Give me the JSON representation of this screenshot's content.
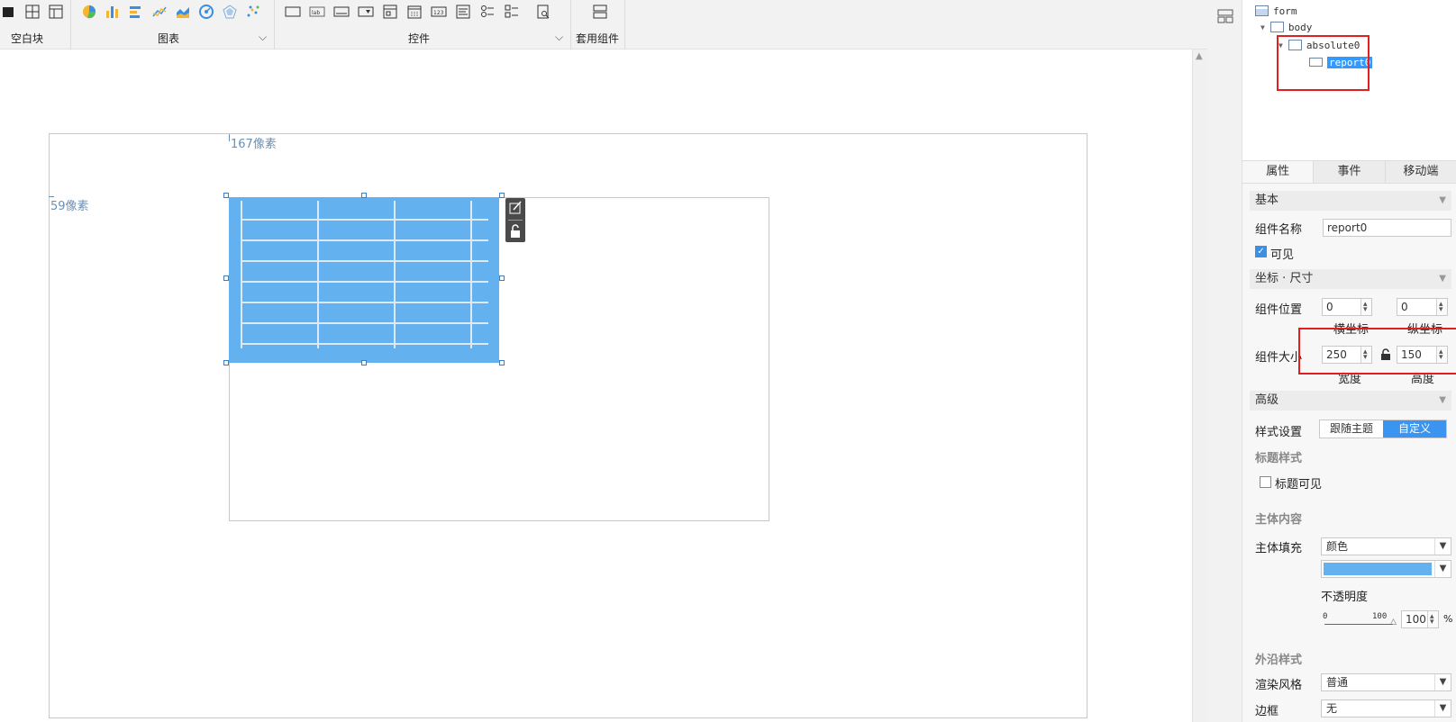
{
  "toolbar": {
    "groups": [
      {
        "label": "空白块"
      },
      {
        "label": "图表"
      },
      {
        "label": "控件"
      },
      {
        "label": "套用组件"
      }
    ]
  },
  "canvas": {
    "ruler_x": "167像素",
    "ruler_y": "59像素"
  },
  "tree": {
    "items": [
      "form",
      "body",
      "absolute0",
      "report0"
    ]
  },
  "tabs": [
    "属性",
    "事件",
    "移动端"
  ],
  "props": {
    "basic": "基本",
    "name_label": "组件名称",
    "name_value": "report0",
    "visible_label": "可见",
    "coord_section": "坐标 · 尺寸",
    "pos_label": "组件位置",
    "pos_x": "0",
    "pos_y": "0",
    "x_caption": "横坐标",
    "y_caption": "纵坐标",
    "size_label": "组件大小",
    "width": "250",
    "height": "150",
    "w_caption": "宽度",
    "h_caption": "高度",
    "advanced": "高级",
    "style_label": "样式设置",
    "style_opt1": "跟随主题",
    "style_opt2": "自定义",
    "title_style": "标题样式",
    "title_visible": "标题可见",
    "body_content": "主体内容",
    "fill_label": "主体填充",
    "fill_value": "颜色",
    "opacity_label": "不透明度",
    "opacity_min": "0",
    "opacity_max": "100",
    "opacity_value": "100",
    "percent": "%",
    "edge_style": "外沿样式",
    "render_label": "渲染风格",
    "render_value": "普通",
    "border_label": "边框",
    "border_value": "无"
  },
  "colors": {
    "accent": "#3b95f0",
    "report_fill": "#64b1ef",
    "highlight": "#e02020"
  }
}
